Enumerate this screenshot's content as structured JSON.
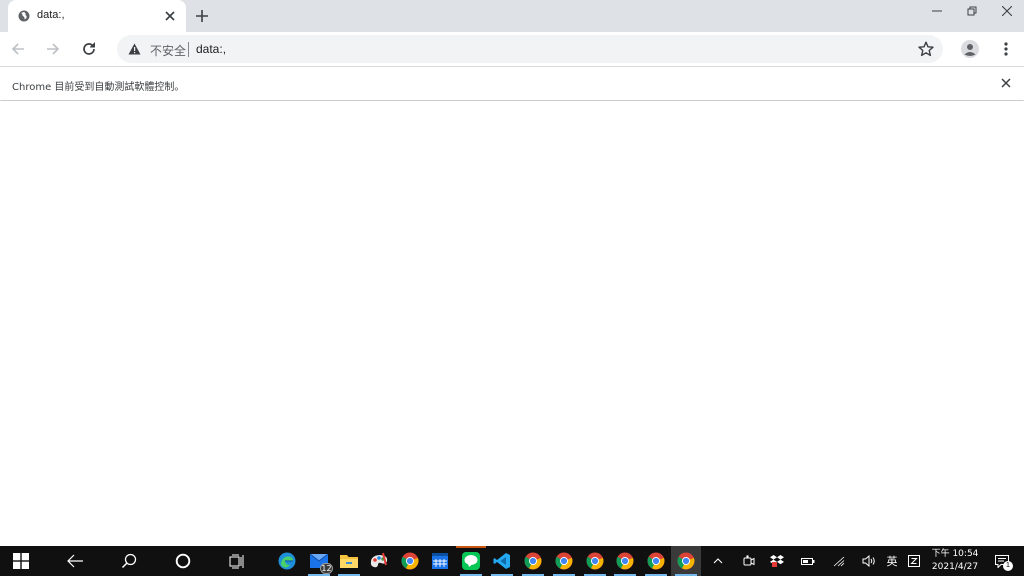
{
  "browser": {
    "tab": {
      "title": "data:,"
    },
    "omnibox": {
      "security_label": "不安全",
      "url": "data:,"
    },
    "infobar": {
      "message": "Chrome 目前受到自動測試軟體控制。"
    }
  },
  "taskbar": {
    "mail_badge": "12",
    "clock": {
      "time": "下午 10:54",
      "date": "2021/4/27"
    },
    "ime_label": "英",
    "notification_count": "1"
  },
  "colors": {
    "accent_blue": "#1a73e8",
    "tabstrip_bg": "#dee1e6",
    "taskbar_bg": "#101010",
    "line_green": "#06c755",
    "vscode_blue": "#23a9f2"
  },
  "icons": {
    "tab": [
      "globe-icon",
      "close-icon",
      "plus-icon"
    ],
    "window": [
      "minimize-icon",
      "restore-icon",
      "close-icon"
    ],
    "toolbar": [
      "back-arrow-icon",
      "forward-arrow-icon",
      "reload-icon",
      "warning-icon",
      "star-icon",
      "profile-icon",
      "kebab-menu-icon"
    ],
    "taskbar": [
      "windows-start-icon",
      "back-arrow-icon",
      "search-icon",
      "cortana-icon",
      "task-view-icon",
      "edge-icon",
      "mail-icon",
      "file-explorer-icon",
      "paint-icon",
      "chrome-icon",
      "calendar-icon",
      "line-icon",
      "vscode-icon"
    ],
    "tray": [
      "chevron-up-icon",
      "meet-now-icon",
      "dropbox-icon",
      "battery-icon",
      "wifi-icon",
      "volume-icon",
      "ime-mode-icon",
      "notification-icon"
    ]
  }
}
